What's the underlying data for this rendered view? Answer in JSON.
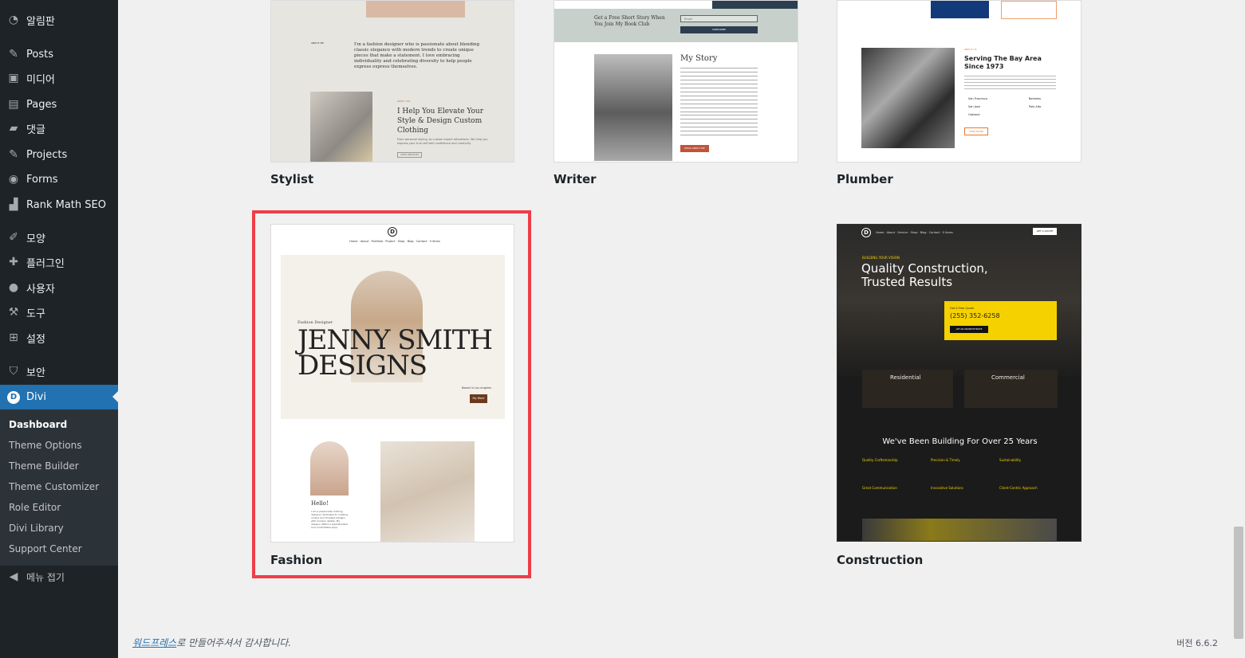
{
  "sidebar": {
    "menu": [
      {
        "label": "알림판",
        "icon": "dashboard-icon"
      },
      {
        "label": "Posts",
        "icon": "pin-icon"
      },
      {
        "label": "미디어",
        "icon": "media-icon"
      },
      {
        "label": "Pages",
        "icon": "page-icon"
      },
      {
        "label": "댓글",
        "icon": "comment-icon"
      },
      {
        "label": "Projects",
        "icon": "pin-icon"
      },
      {
        "label": "Forms",
        "icon": "forms-icon"
      },
      {
        "label": "Rank Math SEO",
        "icon": "chart-icon"
      },
      {
        "label": "모양",
        "icon": "brush-icon"
      },
      {
        "label": "플러그인",
        "icon": "plugin-icon"
      },
      {
        "label": "사용자",
        "icon": "user-icon"
      },
      {
        "label": "도구",
        "icon": "wrench-icon"
      },
      {
        "label": "설정",
        "icon": "settings-icon"
      },
      {
        "label": "보안",
        "icon": "shield-icon"
      },
      {
        "label": "Divi",
        "icon": "divi-icon",
        "badge": "D"
      }
    ],
    "submenu": [
      "Dashboard",
      "Theme Options",
      "Theme Builder",
      "Theme Customizer",
      "Role Editor",
      "Divi Library",
      "Support Center"
    ],
    "collapse_label": "메뉴 접기"
  },
  "layouts": [
    {
      "label": "Stylist"
    },
    {
      "label": "Writer"
    },
    {
      "label": "Plumber"
    },
    {
      "label": "Fashion"
    },
    {
      "label": "Construction"
    }
  ],
  "thumbs": {
    "stylist": {
      "about_tag": "ABOUT ME",
      "intro": "I'm a fashion designer who is passionate about blending classic elegance with modern trends to create unique pieces that make a statement. I love embracing individuality and celebrating diversity to help people express express themselves.",
      "tag": "WHAT I DO",
      "heading": "I Help You Elevate Your Style & Design Custom Clothing",
      "body": "From personal styling, to custom expert alterations. We help you express your true self with confidence and creativity.",
      "button": "VIEW SERVICES"
    },
    "writer": {
      "cta": "Get a Free Short Story When You Join My Book Club",
      "email_placeholder": "Email",
      "subscribe": "SUBSCRIBE",
      "story_title": "My Story",
      "button": "READ ABOUT ME"
    },
    "plumber": {
      "tag": "ABOUT US",
      "heading": "Serving The Bay Area Since 1973",
      "locations": [
        "San Francisco",
        "Berkeley",
        "San Jose",
        "Palo Alto",
        "Oakland"
      ],
      "button": "VIEW MORE"
    },
    "fashion": {
      "logo": "D",
      "nav": "Home · About · Portfolio · Project · Shop · Blog · Contact · 0 items",
      "subtitle": "Fashion Designer",
      "title_line1": "JENNY SMITH",
      "title_line2": "DESIGNS",
      "location": "Based in Los Angeles",
      "button": "My Work",
      "hello": "Hello!",
      "hello_body": "I am a passionate clothing designer dedicated to creating unique and timeless designs with modern details. My designs reflect a sophisticated and comfortable style."
    },
    "construction": {
      "logo": "D",
      "nav": "Home · About · Service · Shop · Blog · Contact · 0 items",
      "nav_button": "GET A QUOTE",
      "tag": "BUILDING YOUR VISION",
      "headline_line1": "Quality Construction,",
      "headline_line2": "Trusted Results",
      "quote_label": "Get A Free Quote",
      "phone": "(255) 352-6258",
      "quote_button": "GET AN ONLINE ESTIMATE",
      "col1": "Residential",
      "col2": "Commercial",
      "building": "We've Been Building For Over 25 Years",
      "features": [
        "Quality Craftsmanship",
        "Precision & Timely",
        "Sustainability",
        "Great Communication",
        "Innovative Solutions",
        "Client-Centric Approach"
      ]
    }
  },
  "footer": {
    "link": "워드프레스",
    "text": "로 만들어주셔서 감사합니다.",
    "version": "버전 6.6.2"
  }
}
